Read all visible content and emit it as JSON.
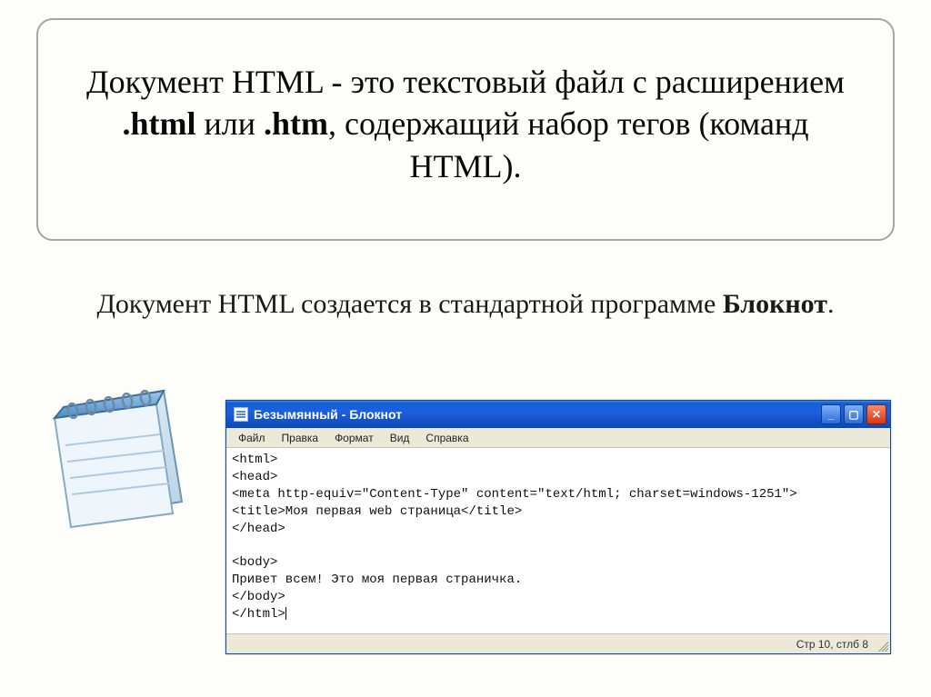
{
  "top": {
    "part1": "Документ HTML - это текстовый файл с расширением ",
    "bold1": ".html",
    "part2": " или ",
    "bold2": ".htm",
    "part3": ", содержащий набор тегов (команд HTML)."
  },
  "middle": {
    "part1": "Документ HTML создается в стандартной программе ",
    "bold1": "Блокнот",
    "part2": "."
  },
  "notepad_window": {
    "title": "Безымянный - Блокнот",
    "menus": [
      "Файл",
      "Правка",
      "Формат",
      "Вид",
      "Справка"
    ],
    "code_lines": [
      "<html>",
      "<head>",
      "<meta http-equiv=\"Content-Type\" content=\"text/html; charset=windows-1251\">",
      "<title>Моя первая web страница</title>",
      "</head>",
      "",
      "<body>",
      "Привет всем! Это моя первая страничка.",
      "</body>",
      "</html>"
    ],
    "status": "Стр 10, стлб 8",
    "btn_min": "_",
    "btn_max": "▢",
    "btn_close": "✕"
  }
}
